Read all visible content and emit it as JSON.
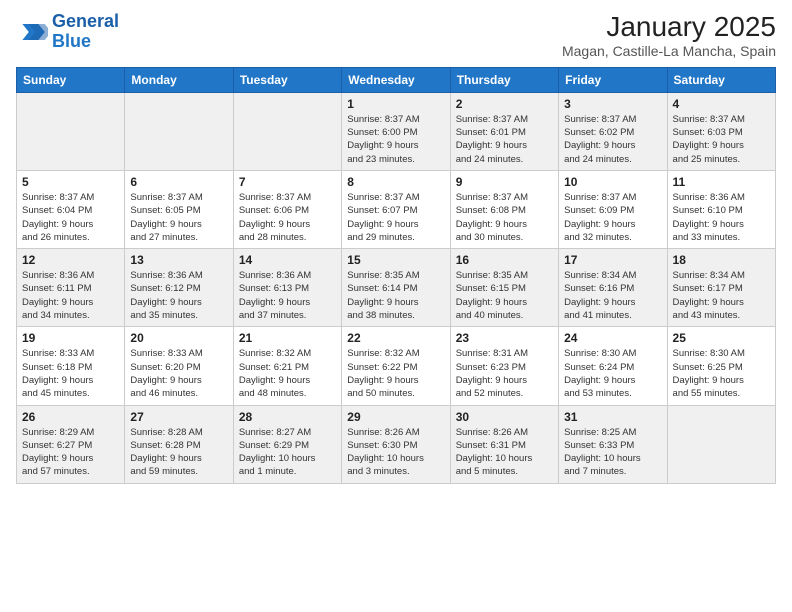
{
  "header": {
    "logo_line1": "General",
    "logo_line2": "Blue",
    "month": "January 2025",
    "location": "Magan, Castille-La Mancha, Spain"
  },
  "weekdays": [
    "Sunday",
    "Monday",
    "Tuesday",
    "Wednesday",
    "Thursday",
    "Friday",
    "Saturday"
  ],
  "weeks": [
    [
      {
        "day": "",
        "text": ""
      },
      {
        "day": "",
        "text": ""
      },
      {
        "day": "",
        "text": ""
      },
      {
        "day": "1",
        "text": "Sunrise: 8:37 AM\nSunset: 6:00 PM\nDaylight: 9 hours\nand 23 minutes."
      },
      {
        "day": "2",
        "text": "Sunrise: 8:37 AM\nSunset: 6:01 PM\nDaylight: 9 hours\nand 24 minutes."
      },
      {
        "day": "3",
        "text": "Sunrise: 8:37 AM\nSunset: 6:02 PM\nDaylight: 9 hours\nand 24 minutes."
      },
      {
        "day": "4",
        "text": "Sunrise: 8:37 AM\nSunset: 6:03 PM\nDaylight: 9 hours\nand 25 minutes."
      }
    ],
    [
      {
        "day": "5",
        "text": "Sunrise: 8:37 AM\nSunset: 6:04 PM\nDaylight: 9 hours\nand 26 minutes."
      },
      {
        "day": "6",
        "text": "Sunrise: 8:37 AM\nSunset: 6:05 PM\nDaylight: 9 hours\nand 27 minutes."
      },
      {
        "day": "7",
        "text": "Sunrise: 8:37 AM\nSunset: 6:06 PM\nDaylight: 9 hours\nand 28 minutes."
      },
      {
        "day": "8",
        "text": "Sunrise: 8:37 AM\nSunset: 6:07 PM\nDaylight: 9 hours\nand 29 minutes."
      },
      {
        "day": "9",
        "text": "Sunrise: 8:37 AM\nSunset: 6:08 PM\nDaylight: 9 hours\nand 30 minutes."
      },
      {
        "day": "10",
        "text": "Sunrise: 8:37 AM\nSunset: 6:09 PM\nDaylight: 9 hours\nand 32 minutes."
      },
      {
        "day": "11",
        "text": "Sunrise: 8:36 AM\nSunset: 6:10 PM\nDaylight: 9 hours\nand 33 minutes."
      }
    ],
    [
      {
        "day": "12",
        "text": "Sunrise: 8:36 AM\nSunset: 6:11 PM\nDaylight: 9 hours\nand 34 minutes."
      },
      {
        "day": "13",
        "text": "Sunrise: 8:36 AM\nSunset: 6:12 PM\nDaylight: 9 hours\nand 35 minutes."
      },
      {
        "day": "14",
        "text": "Sunrise: 8:36 AM\nSunset: 6:13 PM\nDaylight: 9 hours\nand 37 minutes."
      },
      {
        "day": "15",
        "text": "Sunrise: 8:35 AM\nSunset: 6:14 PM\nDaylight: 9 hours\nand 38 minutes."
      },
      {
        "day": "16",
        "text": "Sunrise: 8:35 AM\nSunset: 6:15 PM\nDaylight: 9 hours\nand 40 minutes."
      },
      {
        "day": "17",
        "text": "Sunrise: 8:34 AM\nSunset: 6:16 PM\nDaylight: 9 hours\nand 41 minutes."
      },
      {
        "day": "18",
        "text": "Sunrise: 8:34 AM\nSunset: 6:17 PM\nDaylight: 9 hours\nand 43 minutes."
      }
    ],
    [
      {
        "day": "19",
        "text": "Sunrise: 8:33 AM\nSunset: 6:18 PM\nDaylight: 9 hours\nand 45 minutes."
      },
      {
        "day": "20",
        "text": "Sunrise: 8:33 AM\nSunset: 6:20 PM\nDaylight: 9 hours\nand 46 minutes."
      },
      {
        "day": "21",
        "text": "Sunrise: 8:32 AM\nSunset: 6:21 PM\nDaylight: 9 hours\nand 48 minutes."
      },
      {
        "day": "22",
        "text": "Sunrise: 8:32 AM\nSunset: 6:22 PM\nDaylight: 9 hours\nand 50 minutes."
      },
      {
        "day": "23",
        "text": "Sunrise: 8:31 AM\nSunset: 6:23 PM\nDaylight: 9 hours\nand 52 minutes."
      },
      {
        "day": "24",
        "text": "Sunrise: 8:30 AM\nSunset: 6:24 PM\nDaylight: 9 hours\nand 53 minutes."
      },
      {
        "day": "25",
        "text": "Sunrise: 8:30 AM\nSunset: 6:25 PM\nDaylight: 9 hours\nand 55 minutes."
      }
    ],
    [
      {
        "day": "26",
        "text": "Sunrise: 8:29 AM\nSunset: 6:27 PM\nDaylight: 9 hours\nand 57 minutes."
      },
      {
        "day": "27",
        "text": "Sunrise: 8:28 AM\nSunset: 6:28 PM\nDaylight: 9 hours\nand 59 minutes."
      },
      {
        "day": "28",
        "text": "Sunrise: 8:27 AM\nSunset: 6:29 PM\nDaylight: 10 hours\nand 1 minute."
      },
      {
        "day": "29",
        "text": "Sunrise: 8:26 AM\nSunset: 6:30 PM\nDaylight: 10 hours\nand 3 minutes."
      },
      {
        "day": "30",
        "text": "Sunrise: 8:26 AM\nSunset: 6:31 PM\nDaylight: 10 hours\nand 5 minutes."
      },
      {
        "day": "31",
        "text": "Sunrise: 8:25 AM\nSunset: 6:33 PM\nDaylight: 10 hours\nand 7 minutes."
      },
      {
        "day": "",
        "text": ""
      }
    ]
  ],
  "shaded_rows": [
    0,
    2,
    4
  ]
}
